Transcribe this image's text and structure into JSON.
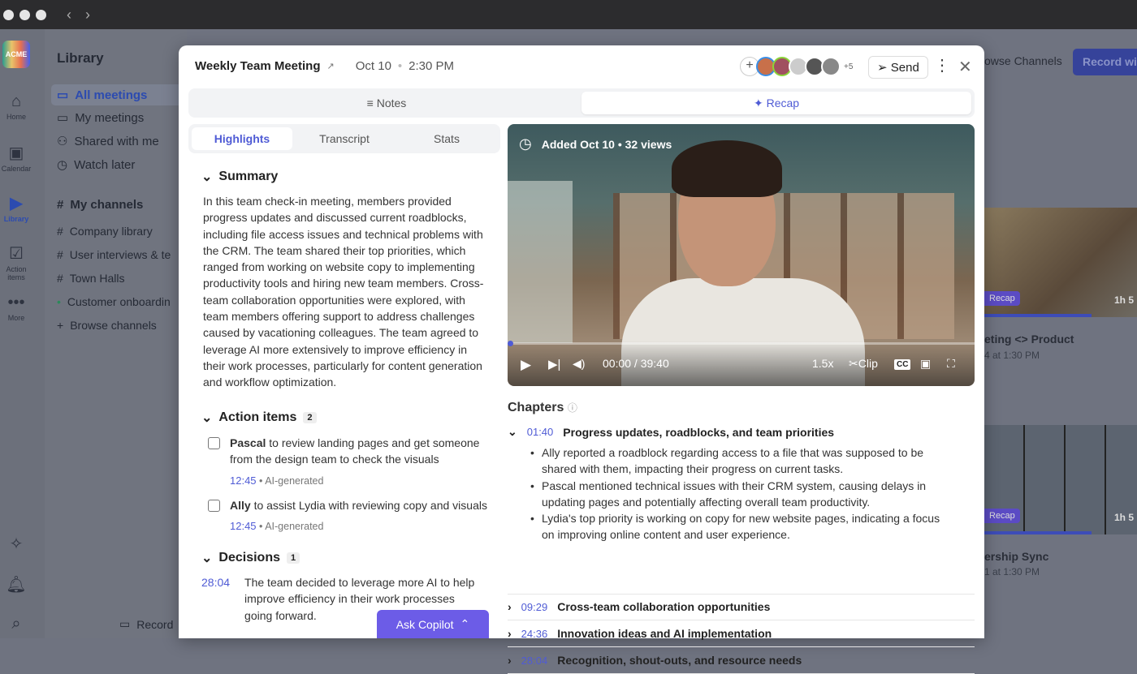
{
  "app": {
    "logo_text": "ACME",
    "rail": [
      "Home",
      "Calendar",
      "Library",
      "Action items",
      "More"
    ],
    "library_title": "Library",
    "library_items": [
      "All meetings",
      "My meetings",
      "Shared with me",
      "Watch later"
    ],
    "channels_title": "My channels",
    "channels": [
      "Company library",
      "User interviews & te",
      "Town Halls",
      "Customer onboardin",
      "Browse channels"
    ],
    "record_label": "Record",
    "browse_channels_btn": "owse Channels",
    "record_with_btn": "Record wit",
    "cards": [
      {
        "badge": "Recap",
        "duration": "1h 5",
        "title": "eting <> Product",
        "sub": "4 at 1:30 PM"
      },
      {
        "badge": "Recap",
        "duration": "1h 5",
        "title": "ership Sync",
        "sub": "1 at 1:30 PM"
      }
    ]
  },
  "modal": {
    "title": "Weekly Team Meeting",
    "date": "Oct 10",
    "time": "2:30 PM",
    "extra_participants": "+5",
    "send": "Send",
    "tabs": [
      "Notes",
      "Recap"
    ],
    "subtabs": [
      "Highlights",
      "Transcript",
      "Stats"
    ],
    "summary_title": "Summary",
    "summary": "In this team check-in meeting, members provided progress updates and discussed current roadblocks, including file access issues and technical problems with the CRM. The team shared their top priorities, which ranged from working on website copy to implementing productivity tools and hiring new team members. Cross-team collaboration opportunities were explored, with team members offering support to address challenges caused by vacationing colleagues. The team agreed to leverage AI more extensively to improve efficiency in their work processes, particularly for content generation and workflow optimization.",
    "action_title": "Action items",
    "action_count": "2",
    "actions": [
      {
        "who": "Pascal",
        "text": " to review landing pages and get someone from the design team to check the visuals",
        "ts": "12:45",
        "tag": "AI-generated"
      },
      {
        "who": "Ally",
        "text": " to assist Lydia with reviewing copy and visuals",
        "ts": "12:45",
        "tag": "AI-generated"
      }
    ],
    "decisions_title": "Decisions",
    "decisions_count": "1",
    "decisions": [
      {
        "ts": "28:04",
        "text": "The team decided to leverage more AI to help improve efficiency in their work processes going forward."
      }
    ],
    "ask_copilot": "Ask Copilot",
    "video": {
      "added": "Added Oct 10 • 32 views",
      "time": "00:00 / 39:40",
      "speed": "1.5x",
      "clip": "Clip",
      "cc": "CC",
      "progress": 0
    },
    "chapters_title": "Chapters",
    "chapters": [
      {
        "ts": "01:40",
        "title": "Progress updates, roadblocks, and team priorities",
        "bullets": [
          "Ally reported a roadblock regarding access to a file that was supposed to be shared with them, impacting their progress on current tasks.",
          "Pascal mentioned technical issues with their CRM system, causing delays in updating pages and potentially affecting overall team productivity.",
          "Lydia's top priority is working on copy for new website pages, indicating a focus on improving online content and user experience."
        ]
      },
      {
        "ts": "09:29",
        "title": "Cross-team collaboration opportunities"
      },
      {
        "ts": "24:36",
        "title": "Innovation ideas and AI implementation"
      },
      {
        "ts": "28:04",
        "title": "Recognition, shout-outs, and resource needs"
      }
    ]
  }
}
